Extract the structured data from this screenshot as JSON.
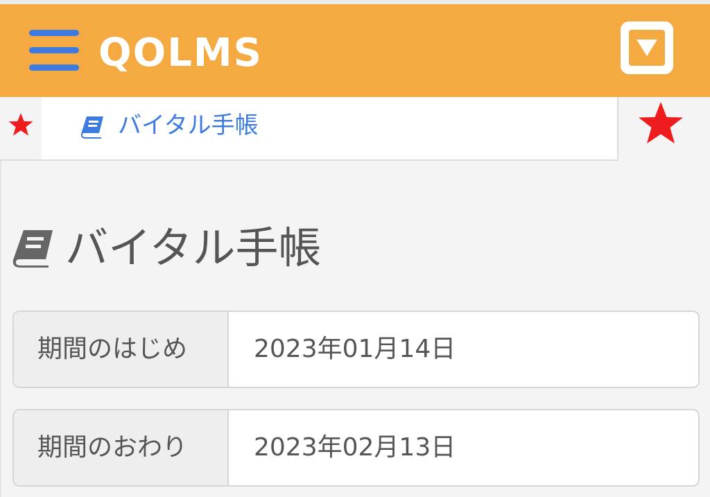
{
  "header": {
    "logo_text": "QOLMS",
    "menu_icon": "hamburger-menu-icon",
    "dropdown_icon": "dropdown-triangle-icon",
    "accent_color": "#f5a941",
    "menu_color": "#3d7be0"
  },
  "tabs": {
    "favorite_icon": "star-icon",
    "active_tab_label": "バイタル手帳",
    "active_tab_icon": "book-icon",
    "star_color": "#ee1c1c"
  },
  "page": {
    "title": "バイタル手帳",
    "title_icon": "book-icon"
  },
  "period": {
    "start_label": "期間のはじめ",
    "start_value": "2023年01月14日",
    "end_label": "期間のおわり",
    "end_value": "2023年02月13日"
  }
}
